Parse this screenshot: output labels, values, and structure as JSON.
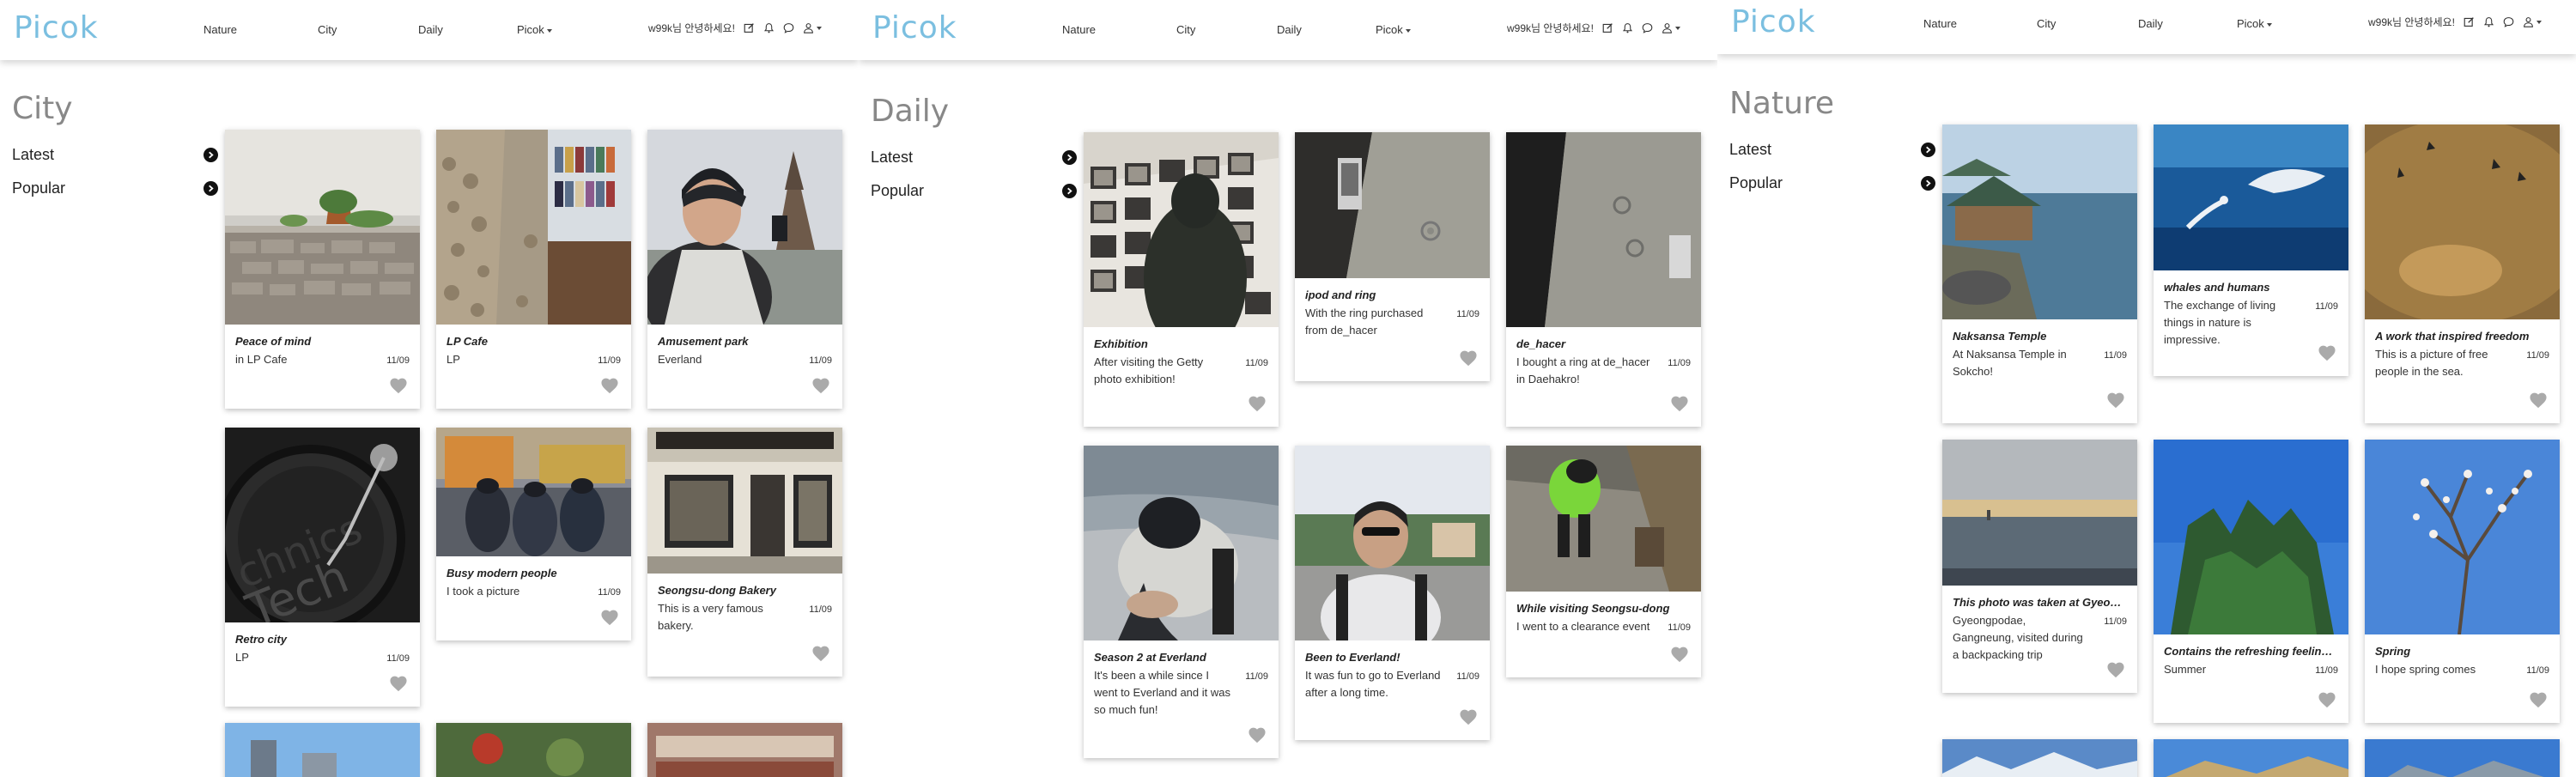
{
  "panels": [
    {
      "logo": "Picok",
      "nav": [
        "Nature",
        "City",
        "Daily",
        "Picok"
      ],
      "greeting": "w99k님 안녕하세요!",
      "category": "City",
      "sort": [
        "Latest",
        "Popular"
      ],
      "cards": [
        {
          "title": "Peace of mind",
          "desc": "in LP Cafe",
          "date": "11/09"
        },
        {
          "title": "LP Cafe",
          "desc": "LP",
          "date": "11/09"
        },
        {
          "title": "Amusement park",
          "desc": "Everland",
          "date": "11/09"
        },
        {
          "title": "Retro city",
          "desc": "LP",
          "date": "11/09"
        },
        {
          "title": "Busy modern people",
          "desc": "I took a picture",
          "date": "11/09"
        },
        {
          "title": "Seongsu-dong Bakery",
          "desc": "This is a very famous bakery.",
          "date": "11/09"
        }
      ]
    },
    {
      "logo": "Picok",
      "nav": [
        "Nature",
        "City",
        "Daily",
        "Picok"
      ],
      "greeting": "w99k님 안녕하세요!",
      "category": "Daily",
      "sort": [
        "Latest",
        "Popular"
      ],
      "cards": [
        {
          "title": "Exhibition",
          "desc": "After visiting the Getty photo exhibition!",
          "date": "11/09"
        },
        {
          "title": "ipod and ring",
          "desc": "With the ring purchased from de_hacer",
          "date": "11/09"
        },
        {
          "title": "de_hacer",
          "desc": "I bought a ring at de_hacer in Daehakro!",
          "date": "11/09"
        },
        {
          "title": "Season 2 at Everland",
          "desc": "It's been a while since I went to Everland and it was so much fun!",
          "date": "11/09"
        },
        {
          "title": "Been to Everland!",
          "desc": "It was fun to go to Everland after a long time.",
          "date": "11/09"
        },
        {
          "title": "While visiting Seongsu-dong",
          "desc": "I went to a clearance event",
          "date": "11/09"
        }
      ]
    },
    {
      "logo": "Picok",
      "nav": [
        "Nature",
        "City",
        "Daily",
        "Picok"
      ],
      "greeting": "w99k님 안녕하세요!",
      "category": "Nature",
      "sort": [
        "Latest",
        "Popular"
      ],
      "cards": [
        {
          "title": "Naksansa Temple",
          "desc": "At Naksansa Temple in Sokcho!",
          "date": "11/09"
        },
        {
          "title": "whales and humans",
          "desc": "The exchange of living things in nature is impressive.",
          "date": "11/09"
        },
        {
          "title": "A work that inspired freedom",
          "desc": "This is a picture of free people in the sea.",
          "date": "11/09"
        },
        {
          "title": "This photo was taken at Gyeong...",
          "desc": "Gyeongpodae, Gangneung, visited during a backpacking trip",
          "date": "11/09"
        },
        {
          "title": "Contains the refreshing feeling ...",
          "desc": "Summer",
          "date": "11/09"
        },
        {
          "title": "Spring",
          "desc": "I hope spring comes",
          "date": "11/09"
        }
      ]
    }
  ]
}
